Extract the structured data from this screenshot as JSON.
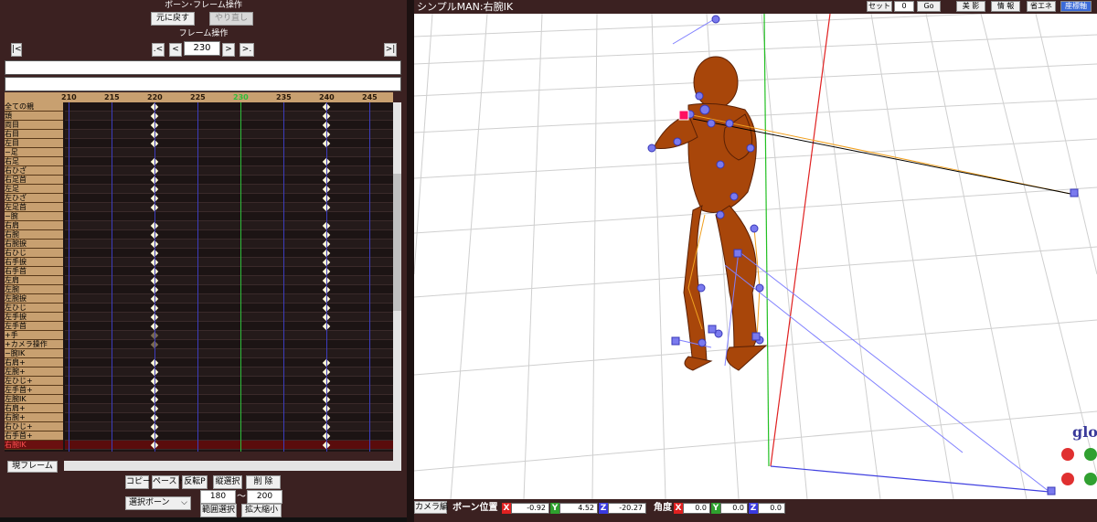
{
  "left_panel": {
    "bone_frame_header": "ボーン･フレーム操作",
    "undo_label": "元に戻す",
    "redo_label": "やり直し",
    "frame_ops_header": "フレーム操作",
    "nav": {
      "first": "|<",
      "prev_key": ".<",
      "prev": "<",
      "next": ">",
      "next_key": ">.",
      "last": ">|"
    },
    "current_frame": "230",
    "ruler_ticks": [
      "210",
      "215",
      "220",
      "225",
      "230",
      "235",
      "240",
      "245"
    ],
    "rows": [
      {
        "label": "全ての親",
        "bg": "#c8a070",
        "keys": [
          220,
          240
        ]
      },
      {
        "label": "頭",
        "bg": "#c8a070",
        "keys": [
          220,
          240
        ]
      },
      {
        "label": "両目",
        "bg": "#c8a070",
        "keys": [
          220,
          240
        ]
      },
      {
        "label": "右目",
        "bg": "#c8a070",
        "keys": [
          220,
          240
        ]
      },
      {
        "label": "左目",
        "bg": "#c8a070",
        "keys": [
          220,
          240
        ]
      },
      {
        "label": "−足",
        "bg": "#c8a070",
        "keys": []
      },
      {
        "label": "右足",
        "bg": "#c8a070",
        "keys": [
          220,
          240
        ]
      },
      {
        "label": "右ひざ",
        "bg": "#c8a070",
        "keys": [
          220,
          240
        ]
      },
      {
        "label": "右足首",
        "bg": "#c8a070",
        "keys": [
          220,
          240
        ]
      },
      {
        "label": "左足",
        "bg": "#c8a070",
        "keys": [
          220,
          240
        ]
      },
      {
        "label": "左ひざ",
        "bg": "#c8a070",
        "keys": [
          220,
          240
        ]
      },
      {
        "label": "左足首",
        "bg": "#c8a070",
        "keys": [
          220,
          240
        ]
      },
      {
        "label": "−腕",
        "bg": "#c8a070",
        "keys": []
      },
      {
        "label": "右肩",
        "bg": "#c8a070",
        "keys": [
          220,
          240
        ]
      },
      {
        "label": "右腕",
        "bg": "#c8a070",
        "keys": [
          220,
          240
        ]
      },
      {
        "label": "右腕捩",
        "bg": "#c8a070",
        "keys": [
          220,
          240
        ]
      },
      {
        "label": "右ひじ",
        "bg": "#c8a070",
        "keys": [
          220,
          240
        ]
      },
      {
        "label": "右手捩",
        "bg": "#c8a070",
        "keys": [
          220,
          240
        ]
      },
      {
        "label": "右手首",
        "bg": "#c8a070",
        "keys": [
          220,
          240
        ]
      },
      {
        "label": "左肩",
        "bg": "#c8a070",
        "keys": [
          220,
          240
        ]
      },
      {
        "label": "左腕",
        "bg": "#c8a070",
        "keys": [
          220,
          240
        ]
      },
      {
        "label": "左腕捩",
        "bg": "#c8a070",
        "keys": [
          220,
          240
        ]
      },
      {
        "label": "左ひじ",
        "bg": "#c8a070",
        "keys": [
          220,
          240
        ]
      },
      {
        "label": "左手捩",
        "bg": "#c8a070",
        "keys": [
          220,
          240
        ]
      },
      {
        "label": "左手首",
        "bg": "#c8a070",
        "keys": [
          220,
          240
        ]
      },
      {
        "label": "+手",
        "bg": "#c8a070",
        "keys": [
          220
        ],
        "dim": true
      },
      {
        "label": "+カメラ操作",
        "bg": "#c8a070",
        "keys": [
          220
        ],
        "dim": true
      },
      {
        "label": "−腕IK",
        "bg": "#c8a070",
        "keys": []
      },
      {
        "label": "右肩+",
        "bg": "#c8a070",
        "keys": [
          220,
          240
        ]
      },
      {
        "label": "左腕+",
        "bg": "#c8a070",
        "keys": [
          220,
          240
        ]
      },
      {
        "label": "左ひじ+",
        "bg": "#c8a070",
        "keys": [
          220,
          240
        ]
      },
      {
        "label": "左手首+",
        "bg": "#c8a070",
        "keys": [
          220,
          240
        ]
      },
      {
        "label": "左腕IK",
        "bg": "#c8a070",
        "keys": [
          220,
          240
        ]
      },
      {
        "label": "右肩+",
        "bg": "#c8a070",
        "keys": [
          220,
          240
        ]
      },
      {
        "label": "右腕+",
        "bg": "#c8a070",
        "keys": [
          220,
          240
        ]
      },
      {
        "label": "右ひじ+",
        "bg": "#c8a070",
        "keys": [
          220,
          240
        ]
      },
      {
        "label": "右手首+",
        "bg": "#c8a070",
        "keys": [
          220,
          240
        ]
      },
      {
        "label": "右腕IK",
        "bg": "#6a1010",
        "keys": [
          220,
          240
        ],
        "selected": true
      }
    ],
    "current_frame_button": "現フレーム",
    "copy_label": "コピー",
    "paste_label": "ペースト",
    "reverse_paste_label": "反転P",
    "vertical_select_label": "縦選択",
    "delete_label": "削 除",
    "select_bone_label": "選択ボーン",
    "range_from": "180",
    "range_to": "200",
    "range_sep": "〜",
    "range_select_label": "範囲選択",
    "scale_label": "拡大縮小"
  },
  "viewport": {
    "title": "シンプルMAN:右腕IK",
    "set_label": "セット",
    "frame_field": "0",
    "go_label": "Go",
    "bisei_label": "美 影",
    "info_label": "情 報",
    "eco_label": "省エネ",
    "axis_label": "座標軸",
    "glo_text": "glo",
    "camera_tab": "カメラ編",
    "bone_pos_label": "ボーン位置",
    "pos": {
      "x": "-0.92",
      "y": "4.52",
      "z": "-20.27"
    },
    "angle_label": "角度",
    "rot": {
      "x": "0.0",
      "y": "0.0",
      "z": "0.0"
    }
  },
  "colors": {
    "accent": "#3b2121",
    "label_bg": "#c8a070",
    "key": "#fff8d8",
    "current_line": "#2ebd3a",
    "model": "#a8460a",
    "bone": "#6a6ae6"
  }
}
